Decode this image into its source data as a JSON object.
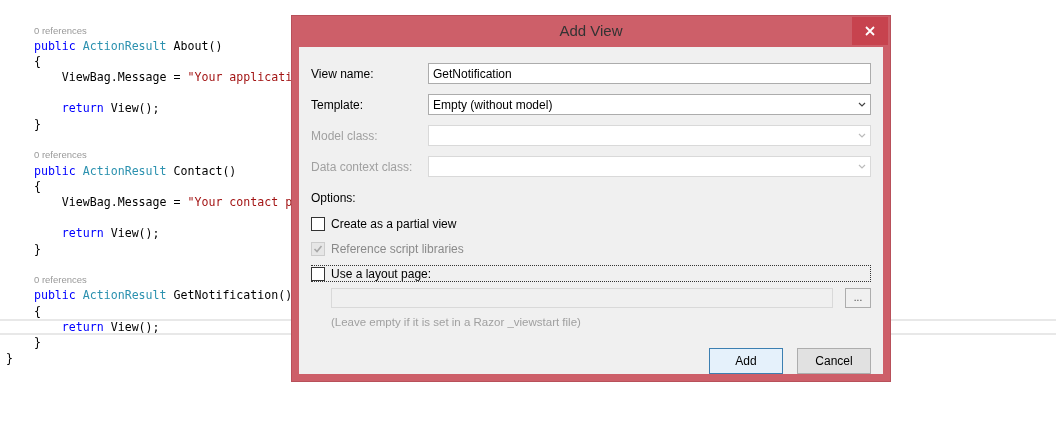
{
  "editor": {
    "lines": [
      {
        "kind": "codelens",
        "text": "0 references"
      },
      {
        "kind": "code",
        "tokens": [
          {
            "kind": "kw",
            "text": "    public "
          },
          {
            "kind": "type",
            "text": "ActionResult "
          },
          {
            "kind": "plain",
            "text": "About()"
          }
        ]
      },
      {
        "kind": "code",
        "tokens": [
          {
            "kind": "plain",
            "text": "    {"
          }
        ]
      },
      {
        "kind": "code",
        "tokens": [
          {
            "kind": "plain",
            "text": "        ViewBag.Message = "
          },
          {
            "kind": "str",
            "text": "\"Your applicati"
          }
        ]
      },
      {
        "kind": "blank"
      },
      {
        "kind": "code",
        "tokens": [
          {
            "kind": "kw",
            "text": "        return "
          },
          {
            "kind": "plain",
            "text": "View();"
          }
        ]
      },
      {
        "kind": "code",
        "tokens": [
          {
            "kind": "plain",
            "text": "    }"
          }
        ]
      },
      {
        "kind": "blank"
      },
      {
        "kind": "codelens",
        "text": "0 references"
      },
      {
        "kind": "code",
        "tokens": [
          {
            "kind": "kw",
            "text": "    public "
          },
          {
            "kind": "type",
            "text": "ActionResult "
          },
          {
            "kind": "plain",
            "text": "Contact()"
          }
        ]
      },
      {
        "kind": "code",
        "tokens": [
          {
            "kind": "plain",
            "text": "    {"
          }
        ]
      },
      {
        "kind": "code",
        "tokens": [
          {
            "kind": "plain",
            "text": "        ViewBag.Message = "
          },
          {
            "kind": "str",
            "text": "\"Your contact p"
          }
        ]
      },
      {
        "kind": "blank"
      },
      {
        "kind": "code",
        "tokens": [
          {
            "kind": "kw",
            "text": "        return "
          },
          {
            "kind": "plain",
            "text": "View();"
          }
        ]
      },
      {
        "kind": "code",
        "tokens": [
          {
            "kind": "plain",
            "text": "    }"
          }
        ]
      },
      {
        "kind": "blank"
      },
      {
        "kind": "codelens",
        "text": "0 references"
      },
      {
        "kind": "code",
        "tokens": [
          {
            "kind": "kw",
            "text": "    public "
          },
          {
            "kind": "type",
            "text": "ActionResult "
          },
          {
            "kind": "plain",
            "text": "GetNotification()"
          }
        ]
      },
      {
        "kind": "code",
        "tokens": [
          {
            "kind": "plain",
            "text": "    {"
          }
        ]
      },
      {
        "kind": "code",
        "current": true,
        "tokens": [
          {
            "kind": "kw",
            "text": "        return "
          },
          {
            "kind": "plain",
            "text": "View();"
          }
        ]
      },
      {
        "kind": "code",
        "tokens": [
          {
            "kind": "plain",
            "text": "    }"
          }
        ]
      },
      {
        "kind": "code",
        "tokens": [
          {
            "kind": "plain",
            "text": "}"
          }
        ]
      }
    ]
  },
  "dialog": {
    "title": "Add View",
    "fields": [
      {
        "kind": "text",
        "label": "View name:",
        "value": "GetNotification",
        "disabled": false
      },
      {
        "kind": "dropdown",
        "label": "Template:",
        "value": "Empty (without model)",
        "disabled": false
      },
      {
        "kind": "dropdown",
        "label": "Model class:",
        "disabled": true
      },
      {
        "kind": "dropdown",
        "label": "Data context class:",
        "disabled": true
      }
    ],
    "options_label": "Options:",
    "options": [
      {
        "label": "Create as a partial view",
        "checked": false,
        "disabled": false,
        "focused": false
      },
      {
        "label": "Reference script libraries",
        "checked": true,
        "disabled": true,
        "focused": false
      },
      {
        "label": "Use a layout page:",
        "checked": false,
        "disabled": false,
        "focused": true
      }
    ],
    "layout_page": {
      "disabled": true,
      "browse_label": "...",
      "hint": "(Leave empty if it is set in a Razor _viewstart file)"
    },
    "buttons": [
      {
        "label": "Add",
        "default": true
      },
      {
        "label": "Cancel",
        "default": false
      }
    ]
  }
}
